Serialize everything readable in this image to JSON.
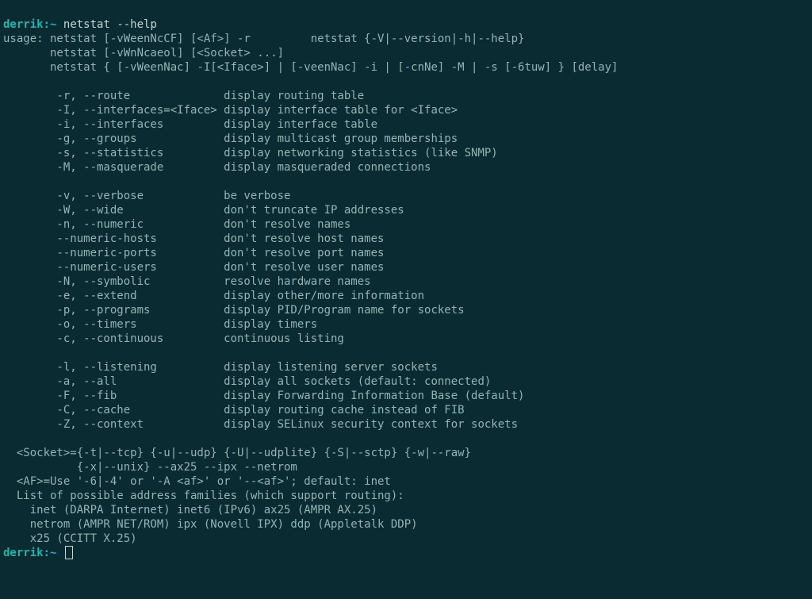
{
  "prompt": {
    "user": "derrik",
    "sep": ":",
    "path": "~"
  },
  "cmd1": "netstat --help",
  "cmd2": "",
  "output": {
    "l0": "usage: netstat [-vWeenNcCF] [<Af>] -r         netstat {-V|--version|-h|--help}",
    "l1": "       netstat [-vWnNcaeol] [<Socket> ...]",
    "l2": "       netstat { [-vWeenNac] -I[<Iface>] | [-veenNac] -i | [-cnNe] -M | -s [-6tuw] } [delay]",
    "l3": "",
    "l4": "        -r, --route              display routing table",
    "l5": "        -I, --interfaces=<Iface> display interface table for <Iface>",
    "l6": "        -i, --interfaces         display interface table",
    "l7": "        -g, --groups             display multicast group memberships",
    "l8": "        -s, --statistics         display networking statistics (like SNMP)",
    "l9": "        -M, --masquerade         display masqueraded connections",
    "l10": "",
    "l11": "        -v, --verbose            be verbose",
    "l12": "        -W, --wide               don't truncate IP addresses",
    "l13": "        -n, --numeric            don't resolve names",
    "l14": "        --numeric-hosts          don't resolve host names",
    "l15": "        --numeric-ports          don't resolve port names",
    "l16": "        --numeric-users          don't resolve user names",
    "l17": "        -N, --symbolic           resolve hardware names",
    "l18": "        -e, --extend             display other/more information",
    "l19": "        -p, --programs           display PID/Program name for sockets",
    "l20": "        -o, --timers             display timers",
    "l21": "        -c, --continuous         continuous listing",
    "l22": "",
    "l23": "        -l, --listening          display listening server sockets",
    "l24": "        -a, --all                display all sockets (default: connected)",
    "l25": "        -F, --fib                display Forwarding Information Base (default)",
    "l26": "        -C, --cache              display routing cache instead of FIB",
    "l27": "        -Z, --context            display SELinux security context for sockets",
    "l28": "",
    "l29": "  <Socket>={-t|--tcp} {-u|--udp} {-U|--udplite} {-S|--sctp} {-w|--raw}",
    "l30": "           {-x|--unix} --ax25 --ipx --netrom",
    "l31": "  <AF>=Use '-6|-4' or '-A <af>' or '--<af>'; default: inet",
    "l32": "  List of possible address families (which support routing):",
    "l33": "    inet (DARPA Internet) inet6 (IPv6) ax25 (AMPR AX.25)",
    "l34": "    netrom (AMPR NET/ROM) ipx (Novell IPX) ddp (Appletalk DDP)",
    "l35": "    x25 (CCITT X.25)"
  }
}
